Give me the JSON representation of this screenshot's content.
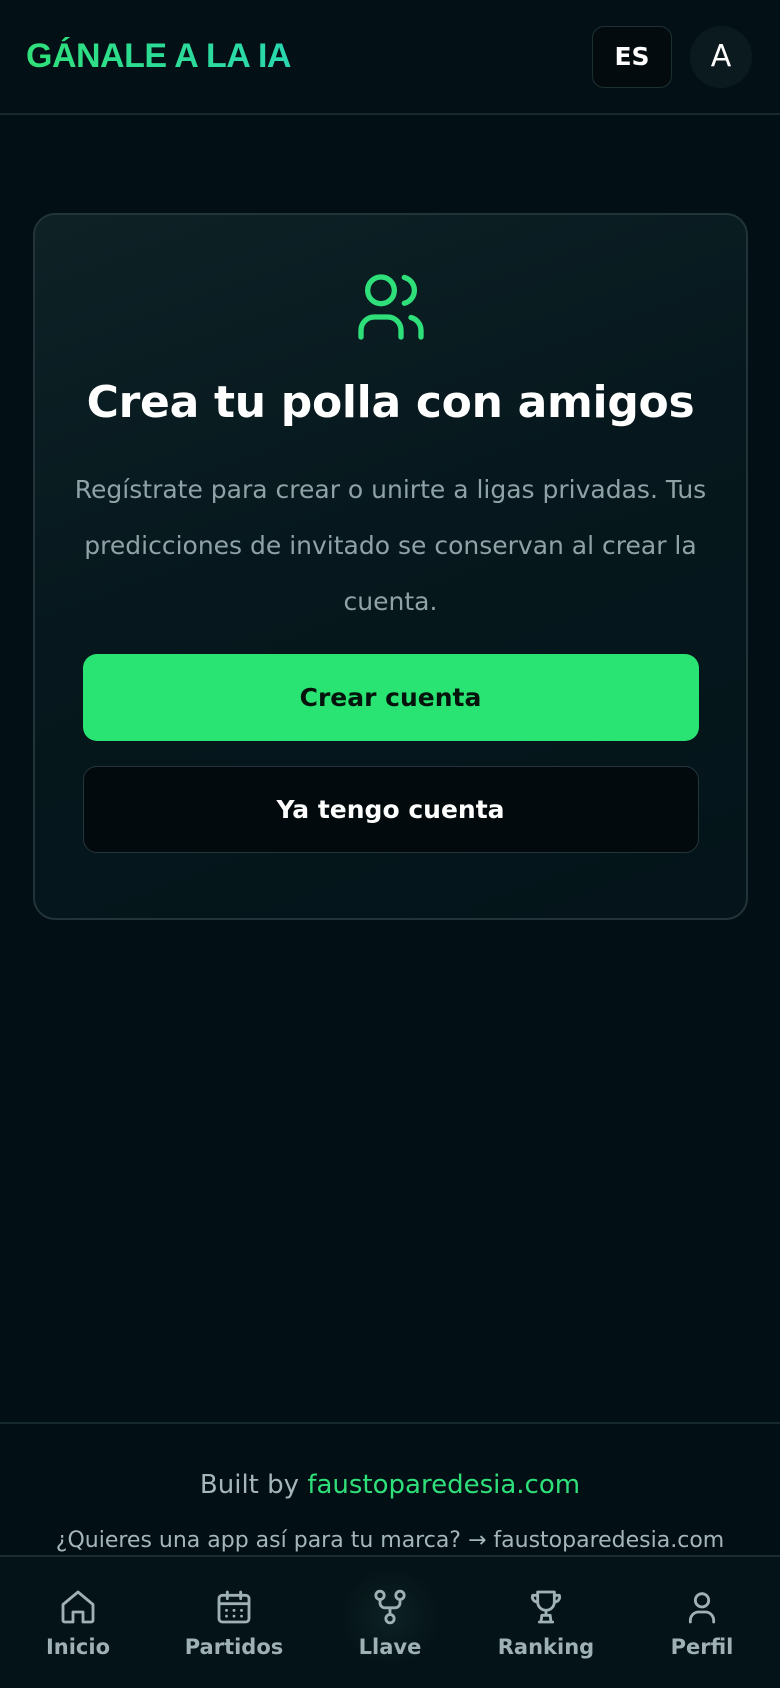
{
  "header": {
    "brand": "GÁNALE A LA IA",
    "language": "ES",
    "avatar_initial": "A"
  },
  "card": {
    "icon": "users-icon",
    "title": "Crea tu polla con amigos",
    "description": "Regístrate para crear o unirte a ligas privadas. Tus predicciones de invitado se conservan al crear la cuenta.",
    "primary_button": "Crear cuenta",
    "secondary_button": "Ya tengo cuenta"
  },
  "footer": {
    "built_by_prefix": "Built by",
    "built_by_link": "faustoparedesia.com",
    "promo": "¿Quieres una app así para tu marca? → faustoparedesia.com"
  },
  "bottom_nav": {
    "items": [
      {
        "label": "Inicio",
        "icon": "home-icon"
      },
      {
        "label": "Partidos",
        "icon": "calendar-icon"
      },
      {
        "label": "Llave",
        "icon": "bracket-icon"
      },
      {
        "label": "Ranking",
        "icon": "trophy-icon"
      },
      {
        "label": "Perfil",
        "icon": "user-icon"
      }
    ]
  },
  "colors": {
    "accent": "#29e372",
    "background": "#020f14",
    "muted_text": "#8fa3a7"
  }
}
